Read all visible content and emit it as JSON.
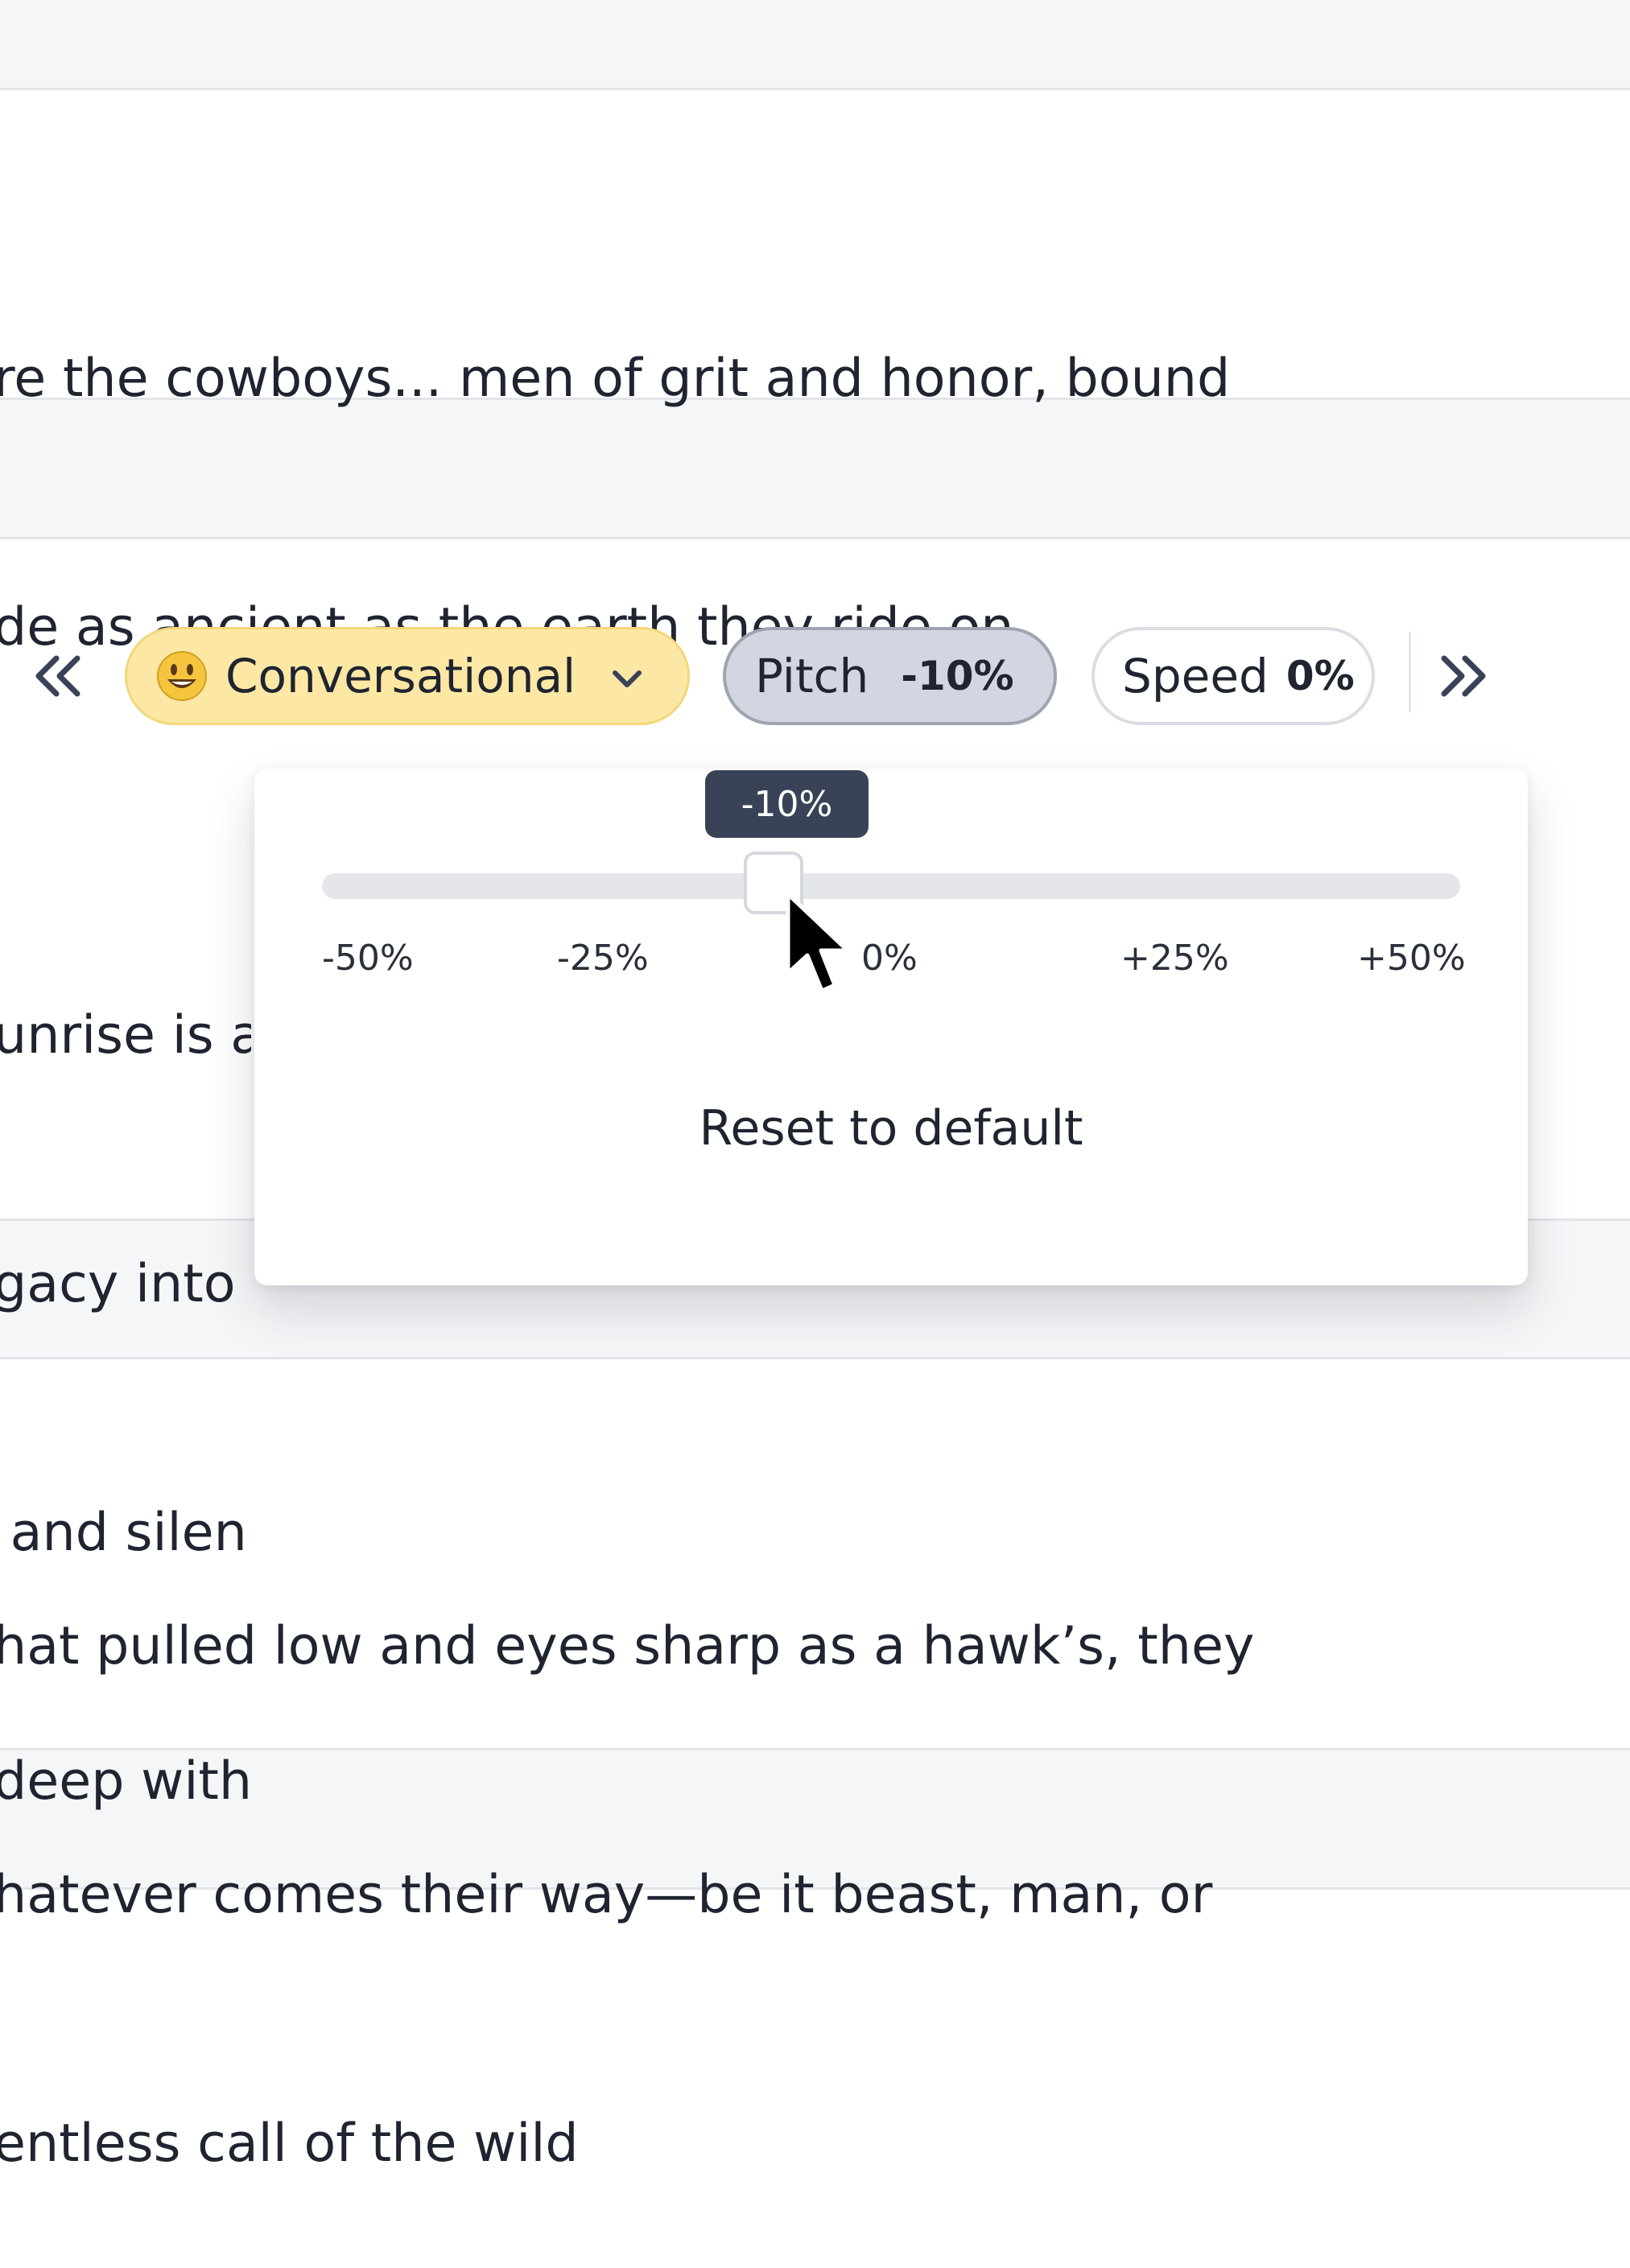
{
  "paragraphs": {
    "top": [
      "re the cowboys... men of grit and honor, bound",
      "de as ancient as the earth they ride on."
    ],
    "middle": [
      "unrise is a",
      "gacy into",
      " and silen",
      "deep withi"
    ],
    "bottom": [
      "hat pulled low and eyes sharp as a hawk’s, they",
      "hatever comes their way—be it beast, man, or",
      "entless call of the wild"
    ]
  },
  "toolbar": {
    "prev_icon": "chevron-double-left-icon",
    "next_icon": "chevron-double-right-icon",
    "style": {
      "emoji": "smiley-emoji-icon",
      "label": "Conversational",
      "dropdown_icon": "chevron-down-icon",
      "color": "#fce8a4"
    },
    "pitch": {
      "label": "Pitch",
      "value": "-10%"
    },
    "speed": {
      "label": "Speed",
      "value": "0%"
    }
  },
  "pitch_popover": {
    "tooltip": "-10%",
    "slider": {
      "min": -50,
      "max": 50,
      "value": -10,
      "unit": "%"
    },
    "ticks": [
      "-50%",
      "-25%",
      "0%",
      "+25%",
      "+50%"
    ],
    "reset_label": "Reset to default"
  },
  "colors": {
    "accent_yellow": "#fce8a4",
    "active_pill": "#d2d6e0",
    "tooltip_bg": "#3a4257"
  }
}
